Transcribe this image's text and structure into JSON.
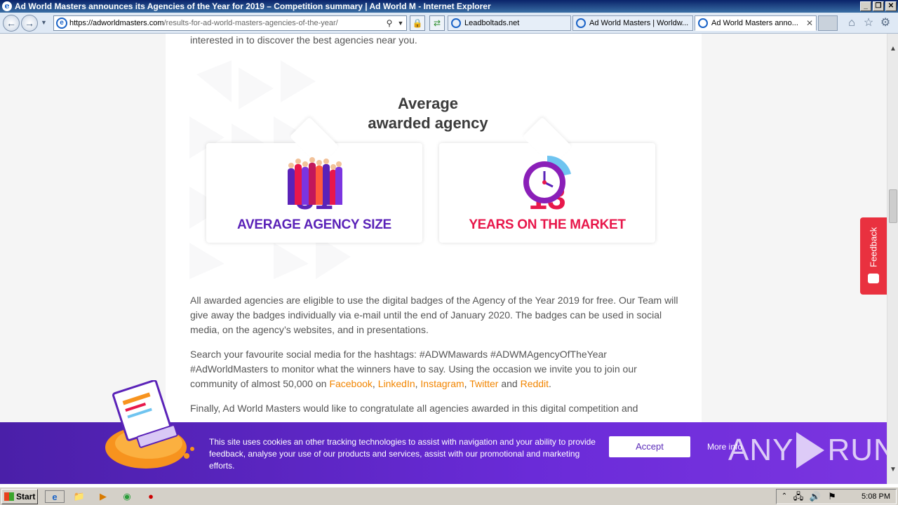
{
  "window": {
    "title": "Ad World Masters announces its Agencies of the Year for 2019 – Competition summary | Ad World M - Internet Explorer",
    "buttons": [
      "_",
      "❐",
      "✕"
    ]
  },
  "address_bar": {
    "url_host": "https://adworldmasters.com",
    "url_path": "/results-for-ad-world-masters-agencies-of-the-year/"
  },
  "tabs": [
    {
      "label": "Leadboltads.net",
      "active": false
    },
    {
      "label": "Ad World Masters | Worldw...",
      "active": false
    },
    {
      "label": "Ad World Masters anno...",
      "active": true
    }
  ],
  "page": {
    "intro": "interested in to discover the best agencies near you.",
    "infographic": {
      "heading_line1": "Average",
      "heading_line2": "awarded agency",
      "stats": [
        {
          "value": "31",
          "label": "AVERAGE AGENCY SIZE",
          "color": "#5a22b8",
          "icon": "team-people-icon"
        },
        {
          "value": "13",
          "label": "YEARS ON THE MARKET",
          "color": "#e8174b",
          "icon": "clock-icon"
        }
      ]
    },
    "para1": "All awarded agencies are eligible to use the digital badges of the Agency of the Year 2019 for free. Our Team will give away the badges individually via e-mail until the end of January 2020. The badges can be used in social media, on the agency’s websites, and in presentations.",
    "para2_before": "Search your favourite social media for the hashtags: #ADWMawards #ADWMAgencyOfTheYear #AdWorldMasters to monitor what the winners have to say. Using the occasion we invite you to join our community of almost 50,000 on ",
    "links": [
      "Facebook",
      "LinkedIn",
      "Instagram",
      "Twitter",
      "Reddit"
    ],
    "sep_comma": ", ",
    "sep_and": " and ",
    "sep_end": ".",
    "para3": "Finally, Ad World Masters would like to congratulate all agencies awarded in this digital competition and",
    "link_color": "#f28500"
  },
  "feedback": {
    "label": "Feedback"
  },
  "cookie_banner": {
    "text": "This site uses cookies an other tracking technologies to assist with navigation and your ability to provide feedback, analyse your use of our products and services, assist with our promotional and marketing efforts.",
    "accept": "Accept",
    "more_info": "More info"
  },
  "watermark": {
    "left": "ANY",
    "right": "RUN"
  },
  "taskbar": {
    "start": "Start",
    "time": "5:08 PM"
  }
}
